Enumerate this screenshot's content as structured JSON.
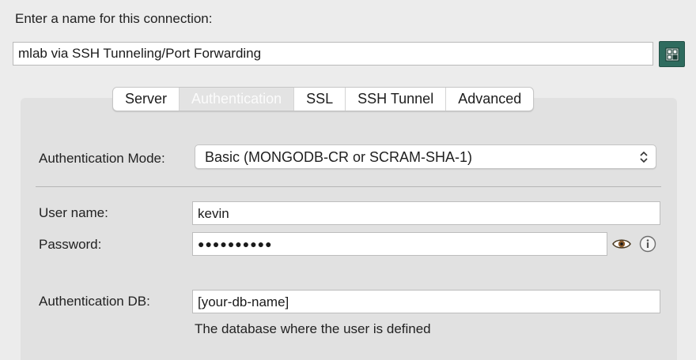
{
  "connection": {
    "prompt_label": "Enter a name for this connection:",
    "name_value": "mlab via SSH Tunneling/Port Forwarding",
    "color_button_icon": "color-grid-icon",
    "color_button_bg": "#2e6b5e"
  },
  "tabs": [
    {
      "label": "Server",
      "active": false
    },
    {
      "label": "Authentication",
      "active": true
    },
    {
      "label": "SSL",
      "active": false
    },
    {
      "label": "SSH Tunnel",
      "active": false
    },
    {
      "label": "Advanced",
      "active": false
    }
  ],
  "auth": {
    "mode_label": "Authentication Mode:",
    "mode_value": "Basic (MONGODB-CR or SCRAM-SHA-1)",
    "user_label": "User name:",
    "user_value": "kevin",
    "password_label": "Password:",
    "password_mask": "●●●●●●●●●●",
    "show_password_icon": "eye-icon",
    "info_icon": "info-icon",
    "db_label": "Authentication DB:",
    "db_value": "[your-db-name]",
    "db_hint": "The database where the user is defined"
  }
}
